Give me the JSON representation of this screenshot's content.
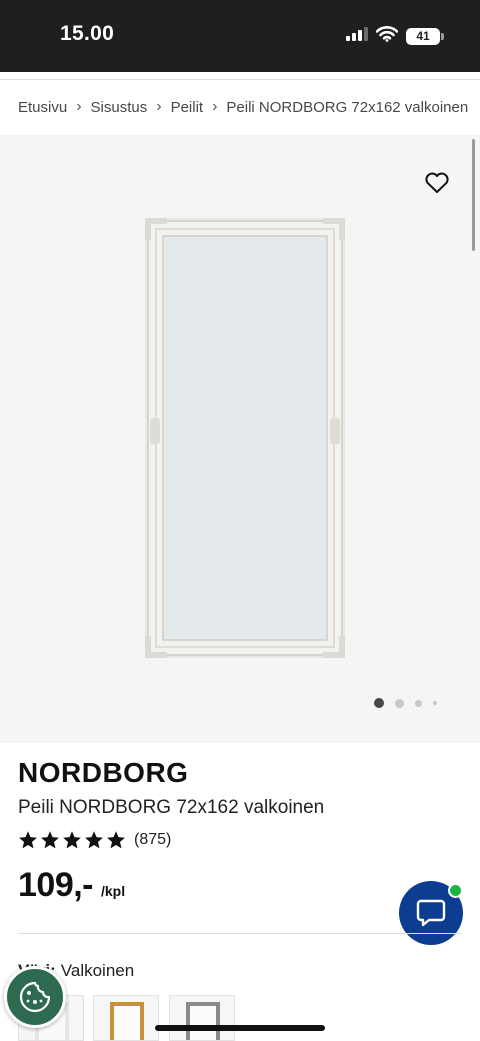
{
  "status_bar": {
    "time": "15.00",
    "battery": "41"
  },
  "breadcrumb": {
    "items": [
      "Etusivu",
      "Sisustus",
      "Peilit",
      "Peili NORDBORG 72x162 valkoinen"
    ]
  },
  "gallery": {
    "image_count": 4,
    "active_index": 0
  },
  "product": {
    "name": "NORDBORG",
    "description": "Peili NORDBORG 72x162 valkoinen",
    "rating": {
      "stars": 5,
      "count": "(875)"
    },
    "price": {
      "value": "109,-",
      "unit": "/kpl"
    }
  },
  "color": {
    "label": "Väri:",
    "value": "Valkoinen"
  },
  "swatches": [
    {
      "name": "white",
      "color": "#f2f2f2"
    },
    {
      "name": "oak",
      "color": "#c8913e"
    },
    {
      "name": "grey",
      "color": "#8a8a8a"
    }
  ],
  "colors": {
    "status_bar_bg": "#1f1f1f",
    "chat_button": "#0d3d91",
    "chat_badge": "#1ab340",
    "cookie_button": "#2d6a4f"
  },
  "icons": [
    "heart-icon",
    "chat-icon",
    "cookie-icon",
    "chevron-right-icon",
    "star-icon",
    "signal-icon",
    "wifi-icon"
  ]
}
